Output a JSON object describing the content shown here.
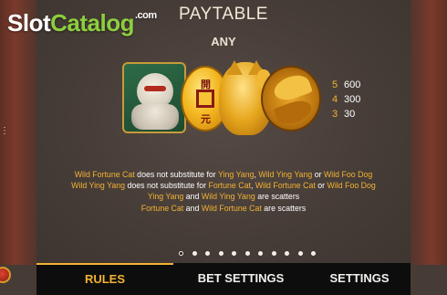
{
  "watermark": {
    "brand_part1": "Slot",
    "brand_part2": "Catalog",
    "suffix": ".com"
  },
  "header": {
    "title": "PAYTABLE",
    "subtitle": "ANY"
  },
  "symbols": [
    "foo-dog-symbol",
    "gold-coin-symbol",
    "fortune-cat-symbol",
    "ying-yang-fish-symbol"
  ],
  "coin_chars": [
    "開",
    "元"
  ],
  "pays": [
    {
      "count": "5",
      "value": "600"
    },
    {
      "count": "4",
      "value": "300"
    },
    {
      "count": "3",
      "value": "30"
    }
  ],
  "description": {
    "line1": {
      "a": "Wild Fortune Cat",
      "b": " does not substitute for ",
      "c": "Ying Yang",
      "d": ", ",
      "e": "Wild Ying Yang",
      "f": " or ",
      "g": "Wild Foo Dog"
    },
    "line2": {
      "a": "Wild Ying Yang",
      "b": " does not substitute for ",
      "c": "Fortune Cat",
      "d": ", ",
      "e": "Wild Fortune Cat",
      "f": " or ",
      "g": "Wild Foo Dog"
    },
    "line3": {
      "a": "Ying Yang",
      "b": " and ",
      "c": "Wild Ying Yang",
      "d": " are scatters"
    },
    "line4": {
      "a": "Fortune Cat",
      "b": " and ",
      "c": "Wild Fortune Cat",
      "d": " are scatters"
    }
  },
  "pagination": {
    "total": 11,
    "active": 0
  },
  "tabs": [
    {
      "label": "RULES",
      "active": true
    },
    {
      "label": "BET SETTINGS",
      "active": false
    },
    {
      "label": "SETTINGS",
      "active": false
    }
  ],
  "colors": {
    "accent": "#f2b233",
    "panel": "#463c37",
    "tabbar": "#0d0d0d",
    "brand_green": "#8ccf3f"
  }
}
